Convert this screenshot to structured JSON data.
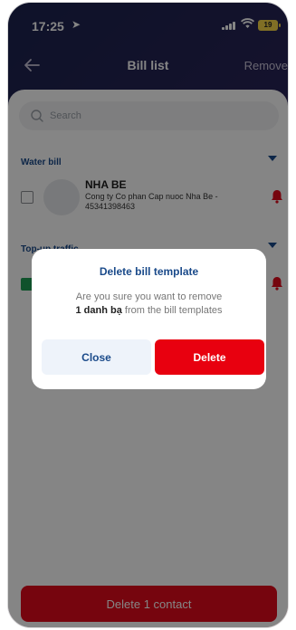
{
  "status_bar": {
    "time": "17:25",
    "location_glyph": "➤",
    "wifi_glyph": "◔",
    "battery": "19"
  },
  "nav": {
    "title": "Bill list",
    "remove_label": "Remove",
    "back_icon": "back-arrow-icon"
  },
  "search": {
    "placeholder": "Search",
    "value": ""
  },
  "sections": [
    {
      "label": "Water bill",
      "items": [
        {
          "name": "NHA BE",
          "description": "Cong ty Co phan Cap nuoc Nha Be - 45341398463",
          "checked": false
        }
      ]
    },
    {
      "label": "Top-up traffic",
      "items": [
        {
          "name": "",
          "description": "",
          "checked": true
        }
      ]
    }
  ],
  "bottom_button": {
    "label": "Delete 1 contact"
  },
  "dialog": {
    "title": "Delete bill template",
    "message_prefix": "Are you sure you want to remove",
    "message_bold": "1 danh bạ",
    "message_suffix": "from the bill templates",
    "close_label": "Close",
    "delete_label": "Delete"
  },
  "colors": {
    "accent_red": "#e8000f",
    "brand_blue": "#1a4a8a",
    "checkbox_green": "#1f9d55",
    "header_gradient_start": "#1c2350",
    "header_gradient_end": "#6b1a2e"
  }
}
